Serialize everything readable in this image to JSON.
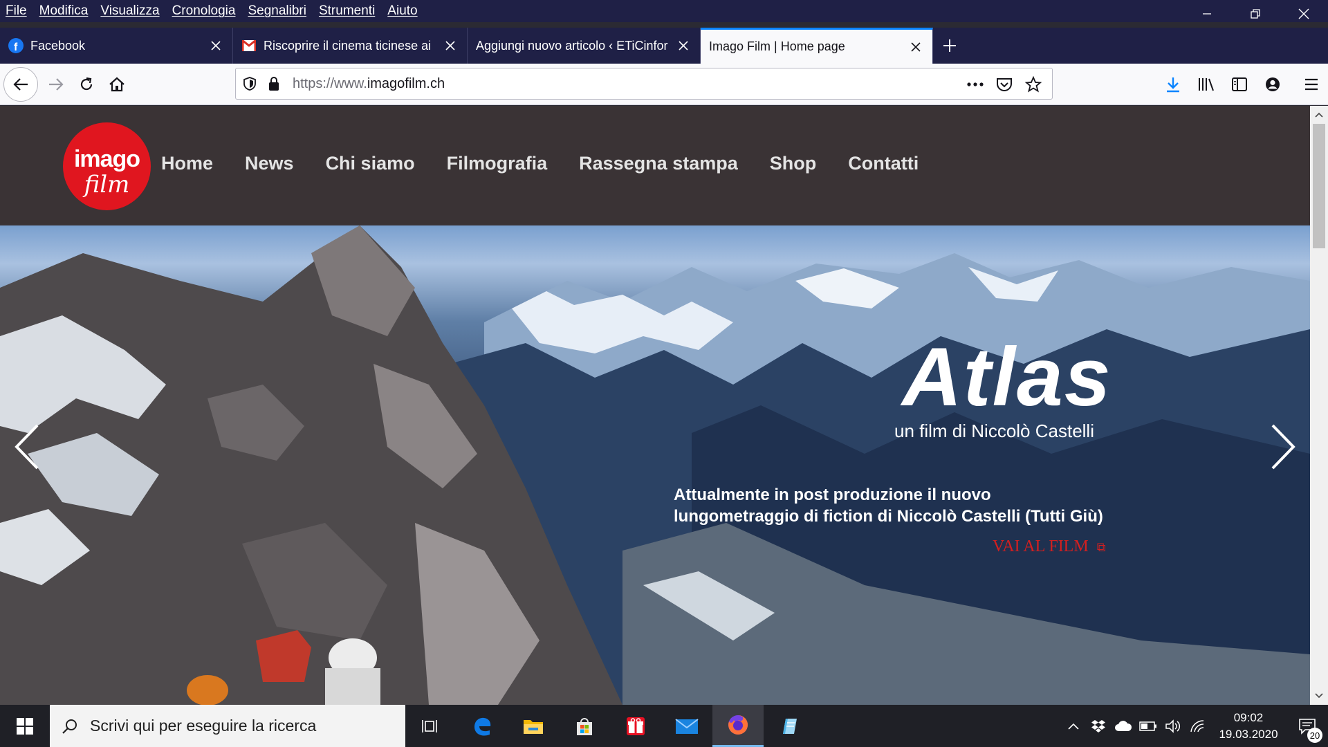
{
  "menu": [
    "File",
    "Modifica",
    "Visualizza",
    "Cronologia",
    "Segnalibri",
    "Strumenti",
    "Aiuto"
  ],
  "tabs": [
    {
      "title": "Facebook",
      "icon": "facebook-icon"
    },
    {
      "title": "Riscoprire il cinema ticinese ai",
      "icon": "gmail-icon"
    },
    {
      "title": "Aggiungi nuovo articolo ‹ ETiCinfor",
      "icon": "none"
    },
    {
      "title": "Imago Film | Home page",
      "icon": "none",
      "active": true
    }
  ],
  "url": {
    "prefix": "https://www.",
    "host": "imagofilm.ch"
  },
  "site": {
    "logo_top": "imago",
    "logo_bottom": "film",
    "nav": [
      "Home",
      "News",
      "Chi siamo",
      "Filmografia",
      "Rassegna stampa",
      "Shop",
      "Contatti"
    ]
  },
  "hero": {
    "title": "Atlas",
    "subtitle": "un film di Niccolò Castelli",
    "description_line1": "Attualmente in post produzione il nuovo",
    "description_line2": "lungometraggio di fiction di Niccolò Castelli (Tutti Giù)",
    "cta": "VAI AL FILM"
  },
  "taskbar": {
    "search_placeholder": "Scrivi qui per eseguire la ricerca",
    "time": "09:02",
    "date": "19.03.2020",
    "notifications": "20"
  },
  "colors": {
    "brand_red": "#e0161f",
    "tab_accent": "#0a84ff",
    "header_bg": "#3a3335",
    "titlebar": "#1f2046"
  }
}
